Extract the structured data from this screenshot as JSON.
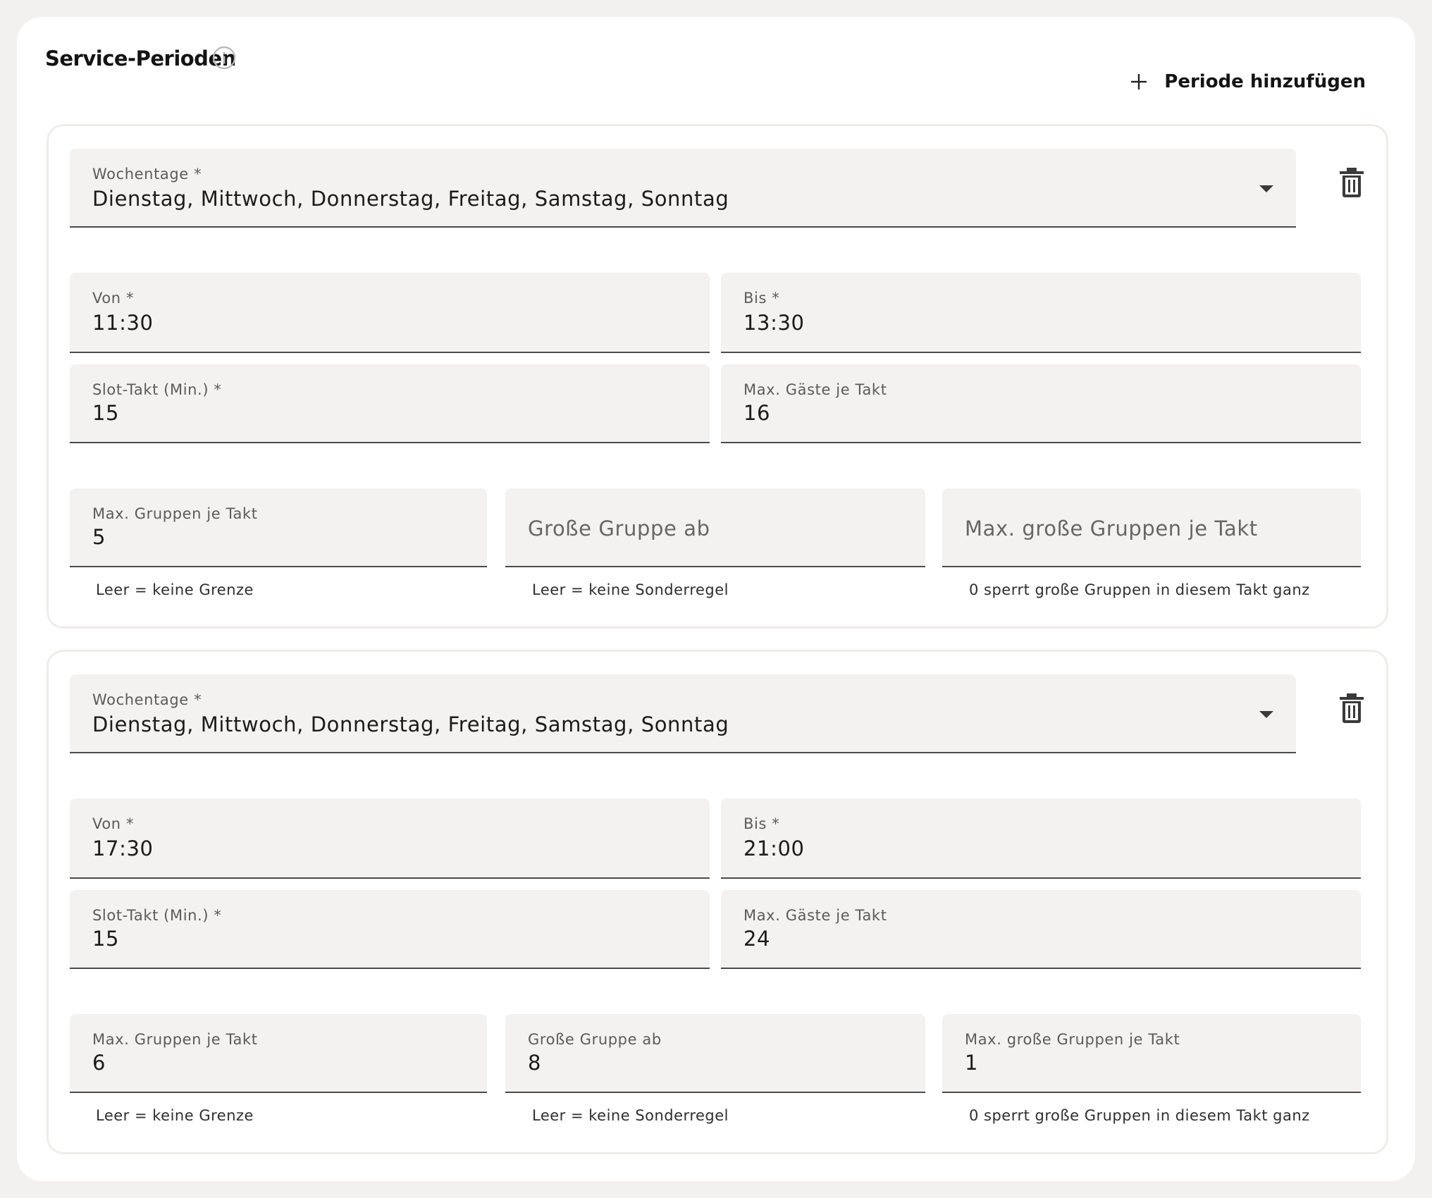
{
  "header": {
    "title": "Service-Perioden",
    "info_icon": "info-icon",
    "add_label": "Periode hinzufügen",
    "add_icon": "plus-icon"
  },
  "periods": [
    {
      "weekdays": {
        "label": "Wochentage *",
        "value": "Dienstag, Mittwoch, Donnerstag, Freitag, Samstag, Sonntag"
      },
      "von": {
        "label": "Von *",
        "value": "11:30"
      },
      "bis": {
        "label": "Bis *",
        "value": "13:30"
      },
      "slot": {
        "label": "Slot-Takt (Min.) *",
        "value": "15"
      },
      "max_guests": {
        "label": "Max. Gäste je Takt",
        "value": "16"
      },
      "max_groups": {
        "label": "Max. Gruppen je Takt",
        "value": "5",
        "helper": "Leer = keine Grenze"
      },
      "large_group": {
        "label": "Große Gruppe ab",
        "value": "",
        "helper": "Leer = keine Sonderregel"
      },
      "max_large_groups": {
        "label": "Max. große Gruppen je Takt",
        "value": "",
        "helper": "0 sperrt große Gruppen in diesem Takt ganz"
      }
    },
    {
      "weekdays": {
        "label": "Wochentage *",
        "value": "Dienstag, Mittwoch, Donnerstag, Freitag, Samstag, Sonntag"
      },
      "von": {
        "label": "Von *",
        "value": "17:30"
      },
      "bis": {
        "label": "Bis *",
        "value": "21:00"
      },
      "slot": {
        "label": "Slot-Takt (Min.) *",
        "value": "15"
      },
      "max_guests": {
        "label": "Max. Gäste je Takt",
        "value": "24"
      },
      "max_groups": {
        "label": "Max. Gruppen je Takt",
        "value": "6",
        "helper": "Leer = keine Grenze"
      },
      "large_group": {
        "label": "Große Gruppe ab",
        "value": "8",
        "helper": "Leer = keine Sonderregel"
      },
      "max_large_groups": {
        "label": "Max. große Gruppen je Takt",
        "value": "1",
        "helper": "0 sperrt große Gruppen in diesem Takt ganz"
      }
    }
  ],
  "icons": {
    "dropdown": "chevron-down-icon",
    "delete": "trash-icon"
  }
}
